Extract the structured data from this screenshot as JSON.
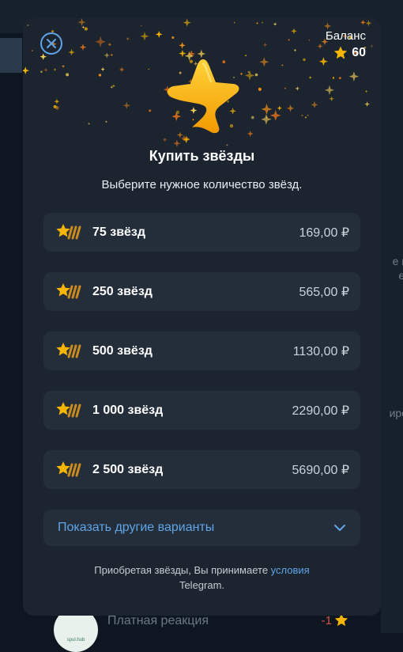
{
  "background": {
    "right_texts": [
      "е н",
      "е.",
      "иро"
    ],
    "bottom_item": {
      "title": "Платная реакция",
      "cost": "-1",
      "avatar_caption": "spul.hub"
    }
  },
  "dialog": {
    "balance_label": "Баланс",
    "balance_value": "60",
    "title": "Купить звёзды",
    "subtitle": "Выберите нужное количество звёзд.",
    "options": [
      {
        "label": "75 звёзд",
        "price": "169,00 ₽"
      },
      {
        "label": "250 звёзд",
        "price": "565,00 ₽"
      },
      {
        "label": "500 звёзд",
        "price": "1130,00 ₽"
      },
      {
        "label": "1 000 звёзд",
        "price": "2290,00 ₽"
      },
      {
        "label": "2 500 звёзд",
        "price": "5690,00 ₽"
      }
    ],
    "more_label": "Показать другие варианты",
    "footer_prefix": "Приобретая звёзды, Вы принимаете ",
    "footer_link": "условия",
    "footer_suffix": "Telegram.",
    "icons": {
      "close": "close-icon",
      "balance": "star-icon",
      "hero": "star-icon",
      "option": "star-stack-icon",
      "more": "chevron-down-icon"
    }
  },
  "colors": {
    "accent": "#5fa5e8",
    "star": "#f7b500",
    "dialog_bg": "#1c242f",
    "option_bg": "#242e3a"
  }
}
